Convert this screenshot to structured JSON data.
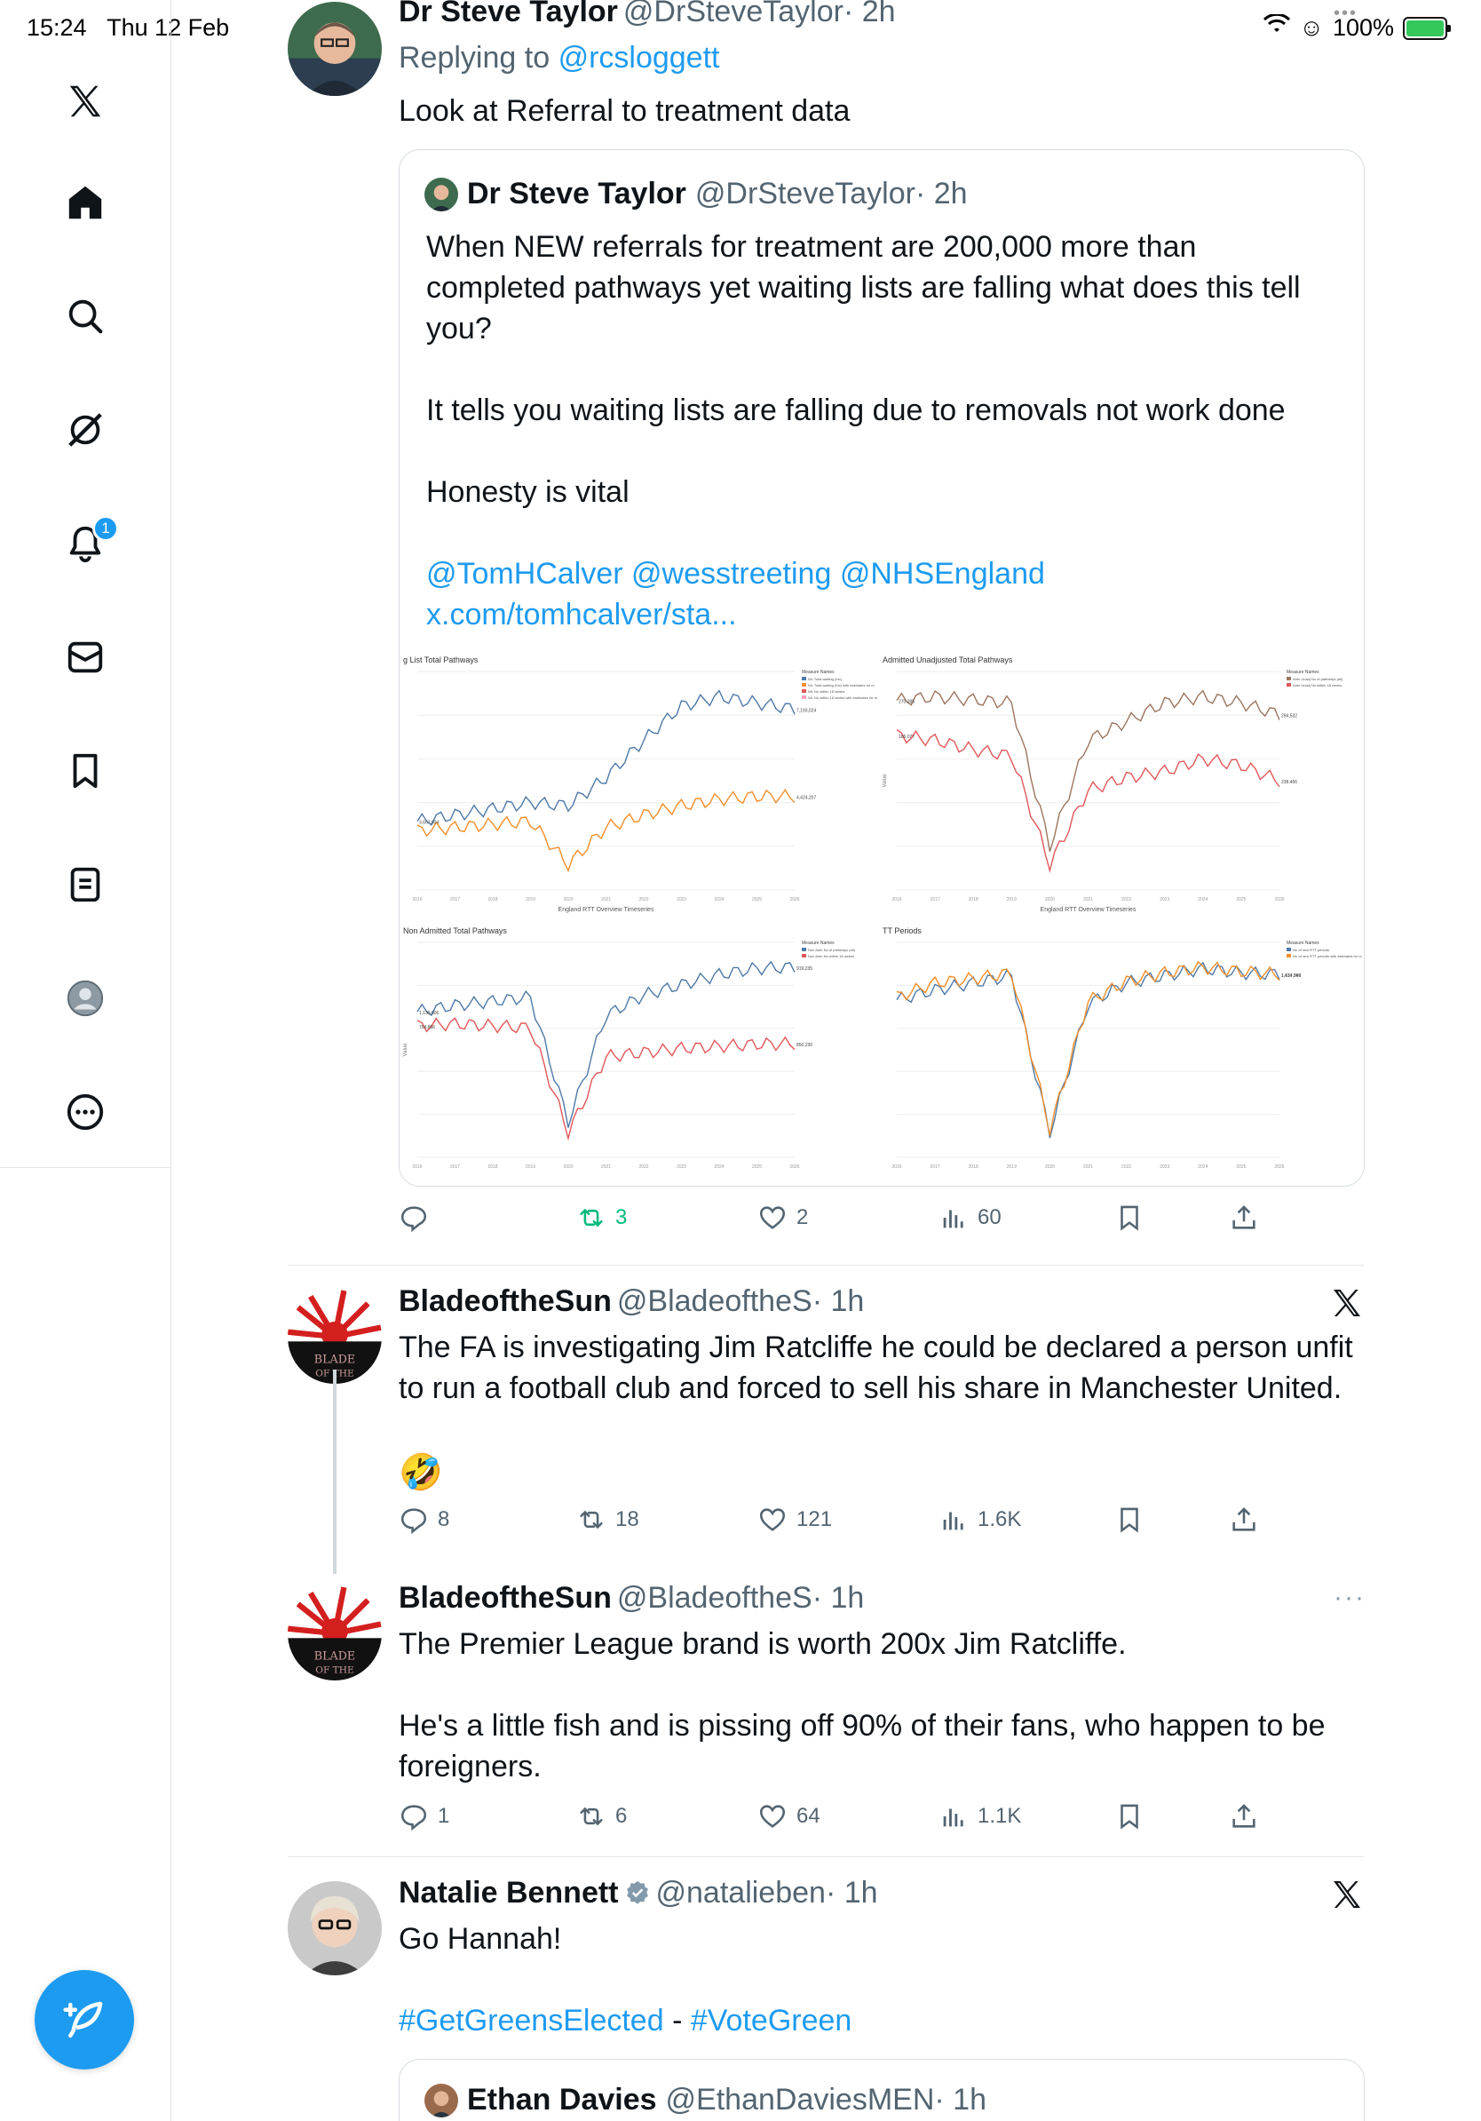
{
  "status_bar": {
    "time": "15:24",
    "date": "Thu 12 Feb",
    "battery": "100%"
  },
  "sidebar": {
    "items": [
      "x-logo",
      "home",
      "search",
      "grok",
      "notifications",
      "messages",
      "bookmarks",
      "lists",
      "profile",
      "more"
    ],
    "notification_count": "1"
  },
  "tweets": [
    {
      "name": "Dr Steve Taylor",
      "handle": "@DrSteveTaylor",
      "time": "· 2h",
      "reply_prefix": "Replying to",
      "reply_to": "@rcsloggett",
      "text": "Look at Referral to treatment data",
      "quote": {
        "name": "Dr Steve Taylor",
        "handle": "@DrSteveTaylor",
        "time": "· 2h",
        "p1": "When NEW referrals for treatment are 200,000 more than completed pathways yet waiting lists are falling what does this tell you?",
        "p2": "It tells you waiting lists are falling due to removals not work done",
        "p3": "Honesty is vital",
        "mentions": "@TomHCalver @wesstreeting @NHSEngland x.com/tomhcalver/sta..."
      },
      "stats": {
        "replies": "",
        "reposts": "3",
        "likes": "2",
        "views": "60"
      }
    },
    {
      "name": "BladeoftheSun",
      "handle": "@BladeoftheS",
      "time": "· 1h",
      "text": "The FA is investigating Jim Ratcliffe he could be declared a person unfit to run a football club and forced to sell his share in Manchester United.",
      "emoji": "🤣",
      "stats": {
        "replies": "8",
        "reposts": "18",
        "likes": "121",
        "views": "1.6K"
      }
    },
    {
      "name": "BladeoftheSun",
      "handle": "@BladeoftheS",
      "time": "· 1h",
      "text1": "The Premier League brand is worth 200x Jim Ratcliffe.",
      "text2": "He's a little fish and is pissing off 90% of their fans, who happen to be foreigners.",
      "stats": {
        "replies": "1",
        "reposts": "6",
        "likes": "64",
        "views": "1.1K"
      }
    },
    {
      "name": "Natalie Bennett",
      "handle": "@natalieben",
      "time": "· 1h",
      "text": "Go Hannah!",
      "hashtag1": "#GetGreensElected",
      "dash": " - ",
      "hashtag2": "#VoteGreen",
      "quote": {
        "name": "Ethan Davies",
        "handle": "@EthanDaviesMEN",
        "time": "· 1h"
      }
    }
  ],
  "chart_data": [
    {
      "type": "line",
      "title": "g List Total Pathways",
      "xlabel": "England RTT Overview Timeseries",
      "x": [
        "2016",
        "2017",
        "2018",
        "2019",
        "2020",
        "2021",
        "2022",
        "2023",
        "2024",
        "2025",
        "2026"
      ],
      "legend_title": "Measure Names",
      "legend": [
        "WL Total waiting (Inc)",
        "WL Total waiting (Inc) with estimates for m",
        "WL No within 18 weeks",
        "WL No within 18 weeks with estimates for m"
      ],
      "series": [
        {
          "name": "WL Total waiting (Inc)",
          "values": [
            3.6,
            3.8,
            4.0,
            4.2,
            4.1,
            5.0,
            6.2,
            7.3,
            7.6,
            7.4,
            7.2
          ]
        },
        {
          "name": "WL No within 18 weeks",
          "values": [
            3.3,
            3.4,
            3.5,
            3.6,
            2.2,
            3.4,
            3.8,
            4.1,
            4.3,
            4.4,
            4.4
          ]
        }
      ],
      "labels": [
        "7,193,024",
        "4,424,207",
        "3,607,604"
      ],
      "colors": [
        "#4e79a7",
        "#f28e2b",
        "#e15759",
        "#ff9dbf"
      ]
    },
    {
      "type": "line",
      "title": "Admitted Unadjusted Total Pathways",
      "xlabel": "England RTT Overview Timeseries",
      "ylabel": "Value",
      "x": [
        "2016",
        "2017",
        "2018",
        "2019",
        "2020",
        "2021",
        "2022",
        "2023",
        "2024",
        "2025",
        "2026"
      ],
      "legend_title": "Measure Names",
      "legend": [
        "Adm Unadj No of pathways (all)",
        "Adm Unadj No within 18 weeks"
      ],
      "series": [
        {
          "name": "Adm Unadj No of pathways (all)",
          "values": [
            294,
            300,
            295,
            290,
            60,
            230,
            260,
            290,
            300,
            290,
            271
          ]
        },
        {
          "name": "Adm Unadj No within 18 weeks",
          "values": [
            238,
            230,
            215,
            205,
            30,
            150,
            170,
            180,
            200,
            190,
            165
          ]
        }
      ],
      "labels": [
        "294,532",
        "238,456",
        "270,395",
        "165,077"
      ],
      "colors": [
        "#9c755f",
        "#e15759"
      ]
    },
    {
      "type": "line",
      "title": "Non Admitted Total Pathways",
      "ylabel": "Value",
      "x": [
        "2016",
        "2017",
        "2018",
        "2019",
        "2020",
        "2021",
        "2022",
        "2023",
        "2024",
        "2025",
        "2026"
      ],
      "legend_title": "Measure Names",
      "legend": [
        "Non Adm No of pathways (all)",
        "Non Adm No within 18 weeks"
      ],
      "series": [
        {
          "name": "Non Adm No of pathways (all)",
          "values": [
            919,
            950,
            970,
            990,
            380,
            900,
            1000,
            1050,
            1100,
            1130,
            1136
          ]
        },
        {
          "name": "Non Adm No within 18 weeks",
          "values": [
            850,
            860,
            850,
            840,
            330,
            700,
            720,
            740,
            750,
            760,
            764
          ]
        }
      ],
      "labels": [
        "919,235",
        "850,230",
        "1,136,006",
        "764,866"
      ],
      "colors": [
        "#4e79a7",
        "#e15759"
      ]
    },
    {
      "type": "line",
      "title": "TT Periods",
      "x": [
        "2016",
        "2017",
        "2018",
        "2019",
        "2020",
        "2021",
        "2022",
        "2023",
        "2024",
        "2025",
        "2026"
      ],
      "legend_title": "Measure Names",
      "legend": [
        "No of new RTT periods",
        "No of new RTT periods with estimates for m"
      ],
      "series": [
        {
          "name": "No of new RTT periods",
          "values": [
            1.43,
            1.5,
            1.55,
            1.6,
            0.5,
            1.4,
            1.55,
            1.6,
            1.65,
            1.62,
            1.61
          ]
        },
        {
          "name": "No of new RTT periods with estimates for m",
          "values": [
            1.45,
            1.55,
            1.58,
            1.62,
            0.52,
            1.42,
            1.56,
            1.62,
            1.66,
            1.63,
            1.61
          ]
        }
      ],
      "labels": [
        "1,434,066",
        "1,617,349"
      ],
      "colors": [
        "#4e79a7",
        "#f28e2b"
      ]
    }
  ]
}
